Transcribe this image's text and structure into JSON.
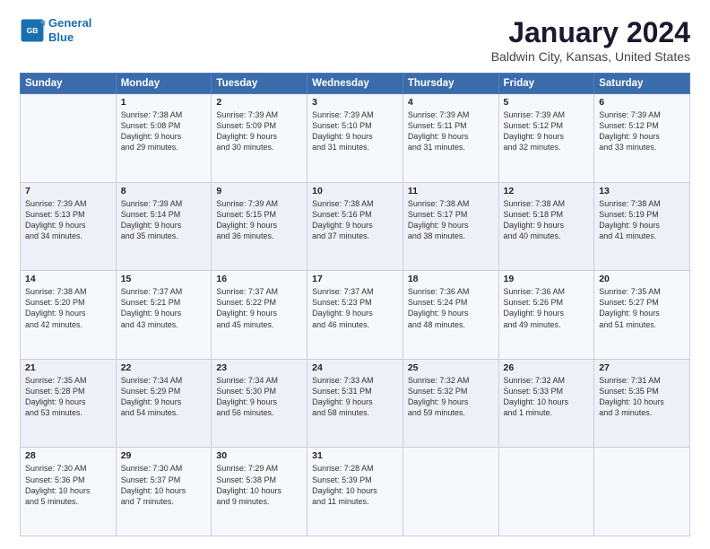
{
  "logo": {
    "line1": "General",
    "line2": "Blue"
  },
  "title": "January 2024",
  "subtitle": "Baldwin City, Kansas, United States",
  "weekdays": [
    "Sunday",
    "Monday",
    "Tuesday",
    "Wednesday",
    "Thursday",
    "Friday",
    "Saturday"
  ],
  "weeks": [
    [
      {
        "day": "",
        "info": ""
      },
      {
        "day": "1",
        "info": "Sunrise: 7:38 AM\nSunset: 5:08 PM\nDaylight: 9 hours\nand 29 minutes."
      },
      {
        "day": "2",
        "info": "Sunrise: 7:39 AM\nSunset: 5:09 PM\nDaylight: 9 hours\nand 30 minutes."
      },
      {
        "day": "3",
        "info": "Sunrise: 7:39 AM\nSunset: 5:10 PM\nDaylight: 9 hours\nand 31 minutes."
      },
      {
        "day": "4",
        "info": "Sunrise: 7:39 AM\nSunset: 5:11 PM\nDaylight: 9 hours\nand 31 minutes."
      },
      {
        "day": "5",
        "info": "Sunrise: 7:39 AM\nSunset: 5:12 PM\nDaylight: 9 hours\nand 32 minutes."
      },
      {
        "day": "6",
        "info": "Sunrise: 7:39 AM\nSunset: 5:12 PM\nDaylight: 9 hours\nand 33 minutes."
      }
    ],
    [
      {
        "day": "7",
        "info": "Sunrise: 7:39 AM\nSunset: 5:13 PM\nDaylight: 9 hours\nand 34 minutes."
      },
      {
        "day": "8",
        "info": "Sunrise: 7:39 AM\nSunset: 5:14 PM\nDaylight: 9 hours\nand 35 minutes."
      },
      {
        "day": "9",
        "info": "Sunrise: 7:39 AM\nSunset: 5:15 PM\nDaylight: 9 hours\nand 36 minutes."
      },
      {
        "day": "10",
        "info": "Sunrise: 7:38 AM\nSunset: 5:16 PM\nDaylight: 9 hours\nand 37 minutes."
      },
      {
        "day": "11",
        "info": "Sunrise: 7:38 AM\nSunset: 5:17 PM\nDaylight: 9 hours\nand 38 minutes."
      },
      {
        "day": "12",
        "info": "Sunrise: 7:38 AM\nSunset: 5:18 PM\nDaylight: 9 hours\nand 40 minutes."
      },
      {
        "day": "13",
        "info": "Sunrise: 7:38 AM\nSunset: 5:19 PM\nDaylight: 9 hours\nand 41 minutes."
      }
    ],
    [
      {
        "day": "14",
        "info": "Sunrise: 7:38 AM\nSunset: 5:20 PM\nDaylight: 9 hours\nand 42 minutes."
      },
      {
        "day": "15",
        "info": "Sunrise: 7:37 AM\nSunset: 5:21 PM\nDaylight: 9 hours\nand 43 minutes."
      },
      {
        "day": "16",
        "info": "Sunrise: 7:37 AM\nSunset: 5:22 PM\nDaylight: 9 hours\nand 45 minutes."
      },
      {
        "day": "17",
        "info": "Sunrise: 7:37 AM\nSunset: 5:23 PM\nDaylight: 9 hours\nand 46 minutes."
      },
      {
        "day": "18",
        "info": "Sunrise: 7:36 AM\nSunset: 5:24 PM\nDaylight: 9 hours\nand 48 minutes."
      },
      {
        "day": "19",
        "info": "Sunrise: 7:36 AM\nSunset: 5:26 PM\nDaylight: 9 hours\nand 49 minutes."
      },
      {
        "day": "20",
        "info": "Sunrise: 7:35 AM\nSunset: 5:27 PM\nDaylight: 9 hours\nand 51 minutes."
      }
    ],
    [
      {
        "day": "21",
        "info": "Sunrise: 7:35 AM\nSunset: 5:28 PM\nDaylight: 9 hours\nand 53 minutes."
      },
      {
        "day": "22",
        "info": "Sunrise: 7:34 AM\nSunset: 5:29 PM\nDaylight: 9 hours\nand 54 minutes."
      },
      {
        "day": "23",
        "info": "Sunrise: 7:34 AM\nSunset: 5:30 PM\nDaylight: 9 hours\nand 56 minutes."
      },
      {
        "day": "24",
        "info": "Sunrise: 7:33 AM\nSunset: 5:31 PM\nDaylight: 9 hours\nand 58 minutes."
      },
      {
        "day": "25",
        "info": "Sunrise: 7:32 AM\nSunset: 5:32 PM\nDaylight: 9 hours\nand 59 minutes."
      },
      {
        "day": "26",
        "info": "Sunrise: 7:32 AM\nSunset: 5:33 PM\nDaylight: 10 hours\nand 1 minute."
      },
      {
        "day": "27",
        "info": "Sunrise: 7:31 AM\nSunset: 5:35 PM\nDaylight: 10 hours\nand 3 minutes."
      }
    ],
    [
      {
        "day": "28",
        "info": "Sunrise: 7:30 AM\nSunset: 5:36 PM\nDaylight: 10 hours\nand 5 minutes."
      },
      {
        "day": "29",
        "info": "Sunrise: 7:30 AM\nSunset: 5:37 PM\nDaylight: 10 hours\nand 7 minutes."
      },
      {
        "day": "30",
        "info": "Sunrise: 7:29 AM\nSunset: 5:38 PM\nDaylight: 10 hours\nand 9 minutes."
      },
      {
        "day": "31",
        "info": "Sunrise: 7:28 AM\nSunset: 5:39 PM\nDaylight: 10 hours\nand 11 minutes."
      },
      {
        "day": "",
        "info": ""
      },
      {
        "day": "",
        "info": ""
      },
      {
        "day": "",
        "info": ""
      }
    ]
  ]
}
